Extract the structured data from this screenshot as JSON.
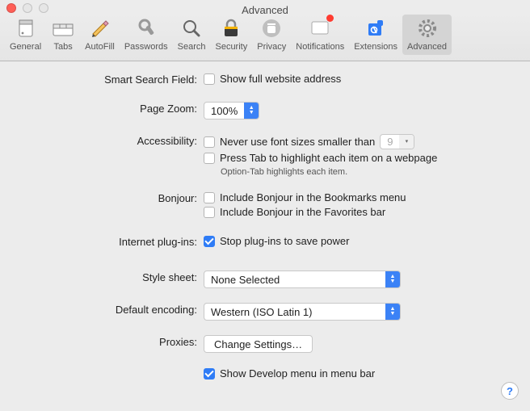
{
  "window": {
    "title": "Advanced"
  },
  "toolbar": {
    "items": [
      {
        "name": "general",
        "label": "General"
      },
      {
        "name": "tabs",
        "label": "Tabs"
      },
      {
        "name": "autofill",
        "label": "AutoFill"
      },
      {
        "name": "passwords",
        "label": "Passwords"
      },
      {
        "name": "search",
        "label": "Search"
      },
      {
        "name": "security",
        "label": "Security"
      },
      {
        "name": "privacy",
        "label": "Privacy"
      },
      {
        "name": "notifications",
        "label": "Notifications",
        "badge": true
      },
      {
        "name": "extensions",
        "label": "Extensions"
      },
      {
        "name": "advanced",
        "label": "Advanced"
      }
    ],
    "selected": "advanced"
  },
  "smart_search": {
    "label": "Smart Search Field:",
    "show_full_url": {
      "label": "Show full website address",
      "checked": false
    }
  },
  "page_zoom": {
    "label": "Page Zoom:",
    "value": "100%"
  },
  "accessibility": {
    "label": "Accessibility:",
    "font_size": {
      "label": "Never use font sizes smaller than",
      "checked": false,
      "value": "9"
    },
    "tab_highlight": {
      "label": "Press Tab to highlight each item on a webpage",
      "checked": false
    },
    "hint": "Option-Tab highlights each item."
  },
  "bonjour": {
    "label": "Bonjour:",
    "bookmarks": {
      "label": "Include Bonjour in the Bookmarks menu",
      "checked": false
    },
    "favorites": {
      "label": "Include Bonjour in the Favorites bar",
      "checked": false
    }
  },
  "plugins": {
    "label": "Internet plug-ins:",
    "stop": {
      "label": "Stop plug-ins to save power",
      "checked": true
    }
  },
  "stylesheet": {
    "label": "Style sheet:",
    "value": "None Selected"
  },
  "encoding": {
    "label": "Default encoding:",
    "value": "Western (ISO Latin 1)"
  },
  "proxies": {
    "label": "Proxies:",
    "button": "Change Settings…"
  },
  "develop": {
    "label": "Show Develop menu in menu bar",
    "checked": true
  },
  "help": "?"
}
